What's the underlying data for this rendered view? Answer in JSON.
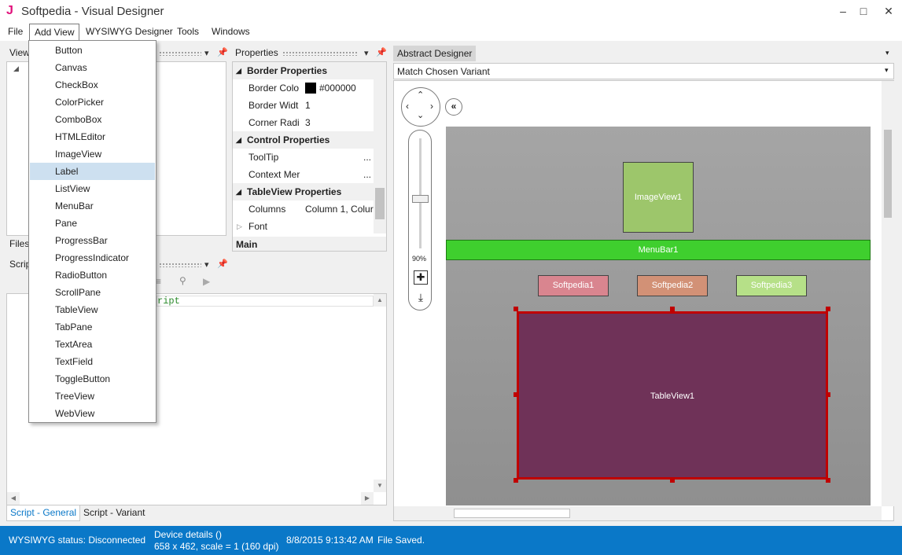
{
  "window": {
    "title": "Softpedia - Visual Designer",
    "icon": "J"
  },
  "menu": [
    "File",
    "Add View",
    "WYSIWYG Designer",
    "Tools",
    "Windows"
  ],
  "add_view_menu": [
    "Button",
    "Canvas",
    "CheckBox",
    "ColorPicker",
    "ComboBox",
    "HTMLEditor",
    "ImageView",
    "Label",
    "ListView",
    "MenuBar",
    "Pane",
    "ProgressBar",
    "ProgressIndicator",
    "RadioButton",
    "ScrollPane",
    "TableView",
    "TabPane",
    "TextArea",
    "TextField",
    "ToggleButton",
    "TreeView",
    "WebView"
  ],
  "add_view_selected": "Label",
  "views_panel": {
    "title": "View"
  },
  "files_tab": "Files",
  "script_panel": {
    "title": "Scrip",
    "code_text": "ript"
  },
  "script_tabs": [
    "Script - General",
    "Script - Variant"
  ],
  "properties": {
    "title": "Properties",
    "sections": {
      "border": "Border Properties",
      "control": "Control Properties",
      "tableview": "TableView Properties",
      "main": "Main"
    },
    "rows": {
      "border_color_name": "Border Colo",
      "border_color_value": "#000000",
      "border_width_name": "Border Widt",
      "border_width_value": "1",
      "corner_radius_name": "Corner Radi",
      "corner_radius_value": "3",
      "tooltip_name": "ToolTip",
      "tooltip_value": "...",
      "context_menu_name": "Context Mer",
      "context_menu_value": "...",
      "columns_name": "Columns",
      "columns_value": "Column 1, Colur",
      "font_name": "Font"
    }
  },
  "designer": {
    "title": "Abstract Designer",
    "variant": "Match Chosen Variant",
    "zoom": "90%",
    "controls": {
      "imageview": "ImageView1",
      "menubar": "MenuBar1",
      "label1": "Softpedia1",
      "label2": "Softpedia2",
      "label3": "Softpedia3",
      "tableview": "TableView1"
    }
  },
  "status": {
    "wysiwyg": "WYSIWYG status: Disconnected",
    "device_line1": "Device details ()",
    "device_line2": "658 x 462, scale = 1 (160 dpi)",
    "timestamp": "8/8/2015 9:13:42 AM",
    "message": "File Saved."
  },
  "colors": {
    "accent": "#0a78c8",
    "imageview": "#9dc66b",
    "menubar": "#3fcf2e",
    "label1": "#d9858f",
    "label2": "#d29176",
    "label3": "#b6e088",
    "tableview": "#6f3258",
    "selection": "#c00000"
  }
}
